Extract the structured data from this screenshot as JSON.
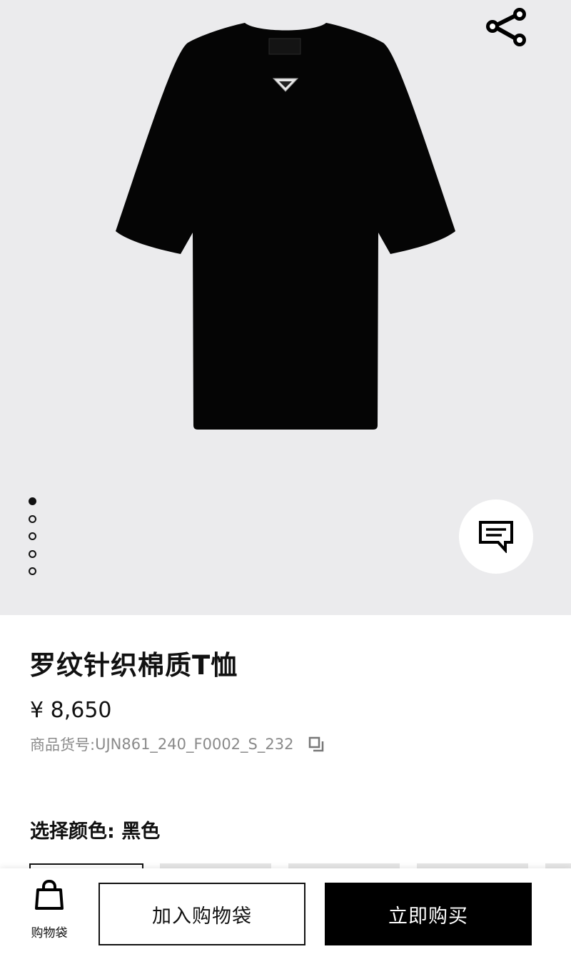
{
  "gallery": {
    "image_label": "black-tshirt-image",
    "background": "#ebebed",
    "slide_count": 5,
    "active_slide": 1,
    "share_icon": "share-icon",
    "chat_icon": "chat-bubble-icon"
  },
  "product": {
    "title": "罗纹针织棉质T恤",
    "price": "¥ 8,650",
    "sku_label": "商品货号: ",
    "sku_value": "UJN861_240_F0002_S_232",
    "copy_icon": "copy-icon",
    "color_label": "选择颜色: 黑色"
  },
  "bottom_bar": {
    "bag_icon": "shopping-bag-icon",
    "bag_label": "购物袋",
    "add_label": "加入购物袋",
    "buy_label": "立即购买"
  },
  "colors": {
    "primary": "#000000",
    "muted_text": "#8a8a8a",
    "swatch": "#e6e6e6"
  }
}
